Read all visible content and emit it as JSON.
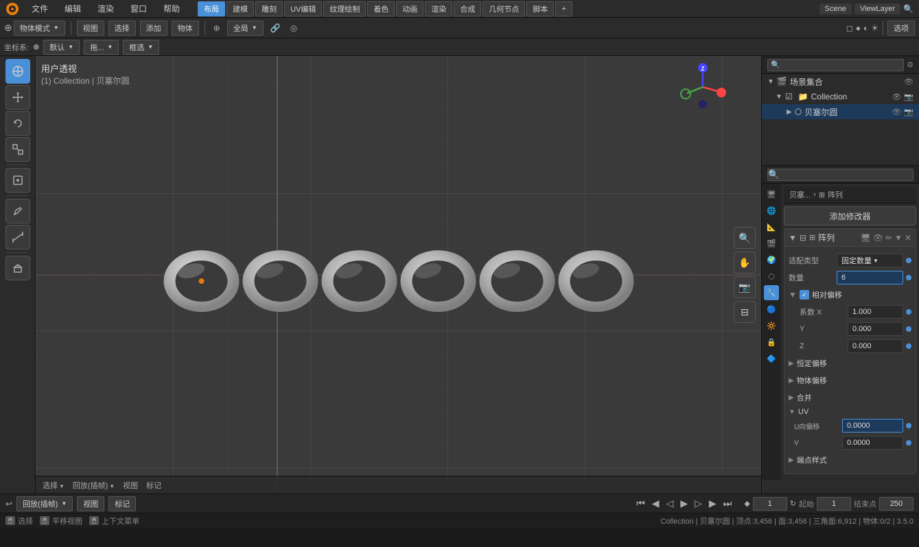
{
  "app": {
    "title": "Blender",
    "version": "3.5.0"
  },
  "top_menu": {
    "logo": "⬡",
    "items": [
      "文件",
      "编辑",
      "渲染",
      "窗口",
      "帮助"
    ]
  },
  "workspace_tabs": [
    "建模",
    "雕刻",
    "UV编辑",
    "纹理绘制",
    "着色",
    "动画",
    "渲染",
    "合成",
    "几何节点",
    "脚本"
  ],
  "active_workspace": "布局",
  "second_toolbar": {
    "mode_label": "物体模式",
    "view_label": "视图",
    "select_label": "选择",
    "add_label": "添加",
    "object_label": "物体",
    "global_label": "全局",
    "options_label": "选项"
  },
  "coords_bar": {
    "coord_system": "默认",
    "drag_label": "拖...",
    "select_mode": "框选"
  },
  "viewport": {
    "view_name": "用户透视",
    "collection_label": "(1) Collection | 贝塞尔圆"
  },
  "outliner": {
    "search_placeholder": "🔍",
    "items": [
      {
        "name": "场景集合",
        "icon": "🎬",
        "expanded": true,
        "level": 0,
        "has_checkbox": true
      },
      {
        "name": "Collection",
        "icon": "📁",
        "expanded": true,
        "level": 1,
        "has_checkbox": true
      },
      {
        "name": "贝塞尔圆",
        "icon": "⬡",
        "expanded": false,
        "level": 2,
        "selected": true
      }
    ]
  },
  "properties": {
    "search_placeholder": "🔍",
    "breadcrumb": {
      "object": "贝塞...",
      "separator": "›",
      "modifier": "阵列",
      "icon": "⊞"
    },
    "add_modifier_label": "添加修改器",
    "modifier": {
      "name": "阵列",
      "fit_type_label": "适配类型",
      "fit_type_value": "固定数量",
      "count_label": "数量",
      "count_value": "6",
      "relative_offset_label": "相对偏移",
      "relative_offset_checked": true,
      "factor_x_label": "系数 X",
      "factor_x_value": "1.000",
      "y_label": "Y",
      "y_value": "0.000",
      "z_label": "Z",
      "z_value": "0.000",
      "const_offset_label": "恒定偏移",
      "obj_offset_label": "物体偏移",
      "merge_label": "合并"
    },
    "uv_section": {
      "label": "UV",
      "u_offset_label": "U向偏移",
      "u_offset_value": "0.0000",
      "v_label": "V",
      "v_value": "0.0000"
    },
    "vertex_style_label": "端点样式",
    "icons": [
      "🖥",
      "🌐",
      "📐",
      "🎯",
      "✨",
      "🎨",
      "🔧",
      "🔵",
      "🔆",
      "🔒",
      "🔷"
    ]
  },
  "timeline": {
    "frame_current": "1",
    "frame_start": "起始",
    "frame_start_val": "1",
    "frame_end": "结束点",
    "frame_end_val": "250",
    "playback_speed": "回放(插帧)",
    "view_label": "视图",
    "marker_label": "标记"
  },
  "status_bar": {
    "select_label": "选择",
    "view_label": "平移视图",
    "menu_label": "上下文菜单",
    "stats": "Collection | 贝塞尔圆 | 顶点:3,456 | 面:3,456 | 三角面:6,912 | 物体:0/2 | 3.5.0"
  }
}
